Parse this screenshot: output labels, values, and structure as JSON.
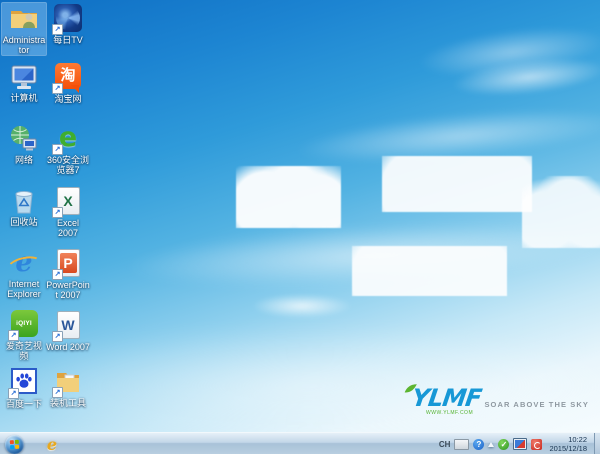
{
  "desktop": {
    "icons": [
      {
        "label": "Administrator"
      },
      {
        "label": "每日TV"
      },
      {
        "label": "计算机"
      },
      {
        "label": "淘宝网"
      },
      {
        "label": "网络"
      },
      {
        "label": "360安全浏览器7"
      },
      {
        "label": "回收站"
      },
      {
        "label": "Excel 2007"
      },
      {
        "label": "Internet Explorer"
      },
      {
        "label": "PowerPoint 2007"
      },
      {
        "label": "爱奇艺视频"
      },
      {
        "label": "Word 2007"
      },
      {
        "label": "百度一下"
      },
      {
        "label": "装机工具"
      }
    ],
    "logo": {
      "wordmark": "YLMF",
      "tagline": "SOAR ABOVE THE SKY",
      "subtext": "WWW.YLMF.COM"
    }
  },
  "icon_art": {
    "shortcut_glyph": "↗",
    "taobao_char": "淘",
    "e360_letter": "e",
    "ie_letter": "e",
    "excel_letter": "X",
    "ppt_letter": "P",
    "word_letter": "W",
    "iqiyi_text": "iQIYI"
  },
  "taskbar": {
    "language_indicator": "CH",
    "ie_button_letter": "e",
    "help_glyph": "?",
    "check_glyph": "✓",
    "clock": {
      "time": "10:22",
      "date": "2015/12/18"
    }
  },
  "colors": {
    "sky_top": "#0e6ec4",
    "sky_bottom": "#f6fcfe",
    "logo_blue": "#1798d6",
    "logo_green": "#55b331",
    "taobao_orange": "#f4500a",
    "iqiyi_green": "#3ba41e",
    "taskbar_tint": "#b8cee0"
  }
}
